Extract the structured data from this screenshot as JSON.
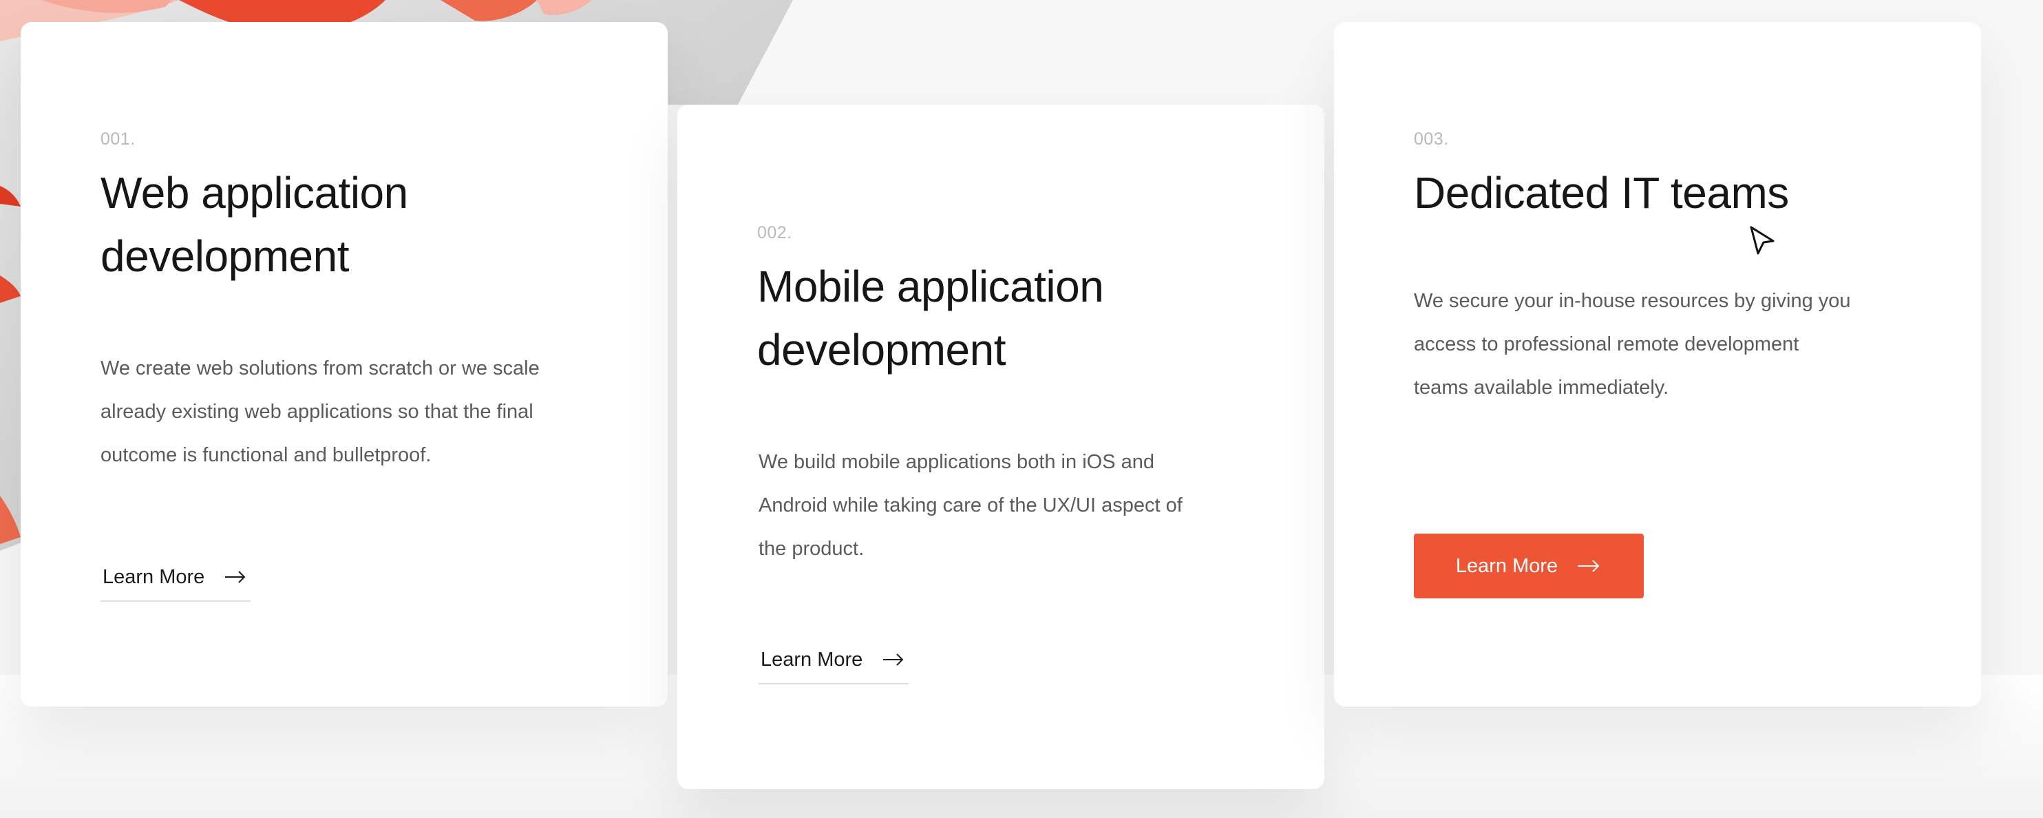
{
  "accent_color": "#ed5534",
  "cards": [
    {
      "number": "001.",
      "title": "Web application development",
      "description": "We create web solutions from scratch or we scale already existing web applications so that the final outcome is functional and bulletproof.",
      "cta": "Learn More",
      "cta_style": "link",
      "icon": "arrow-right-icon"
    },
    {
      "number": "002.",
      "title": "Mobile application development",
      "description": "We build mobile applications both in iOS and Android while taking care of the UX/UI aspect of the product.",
      "cta": "Learn More",
      "cta_style": "link",
      "icon": "arrow-right-icon"
    },
    {
      "number": "003.",
      "title": "Dedicated IT teams",
      "description": "We secure your in-house resources by giving you access to professional remote development teams available immediately.",
      "cta": "Learn More",
      "cta_style": "button",
      "icon": "arrow-right-icon"
    }
  ]
}
